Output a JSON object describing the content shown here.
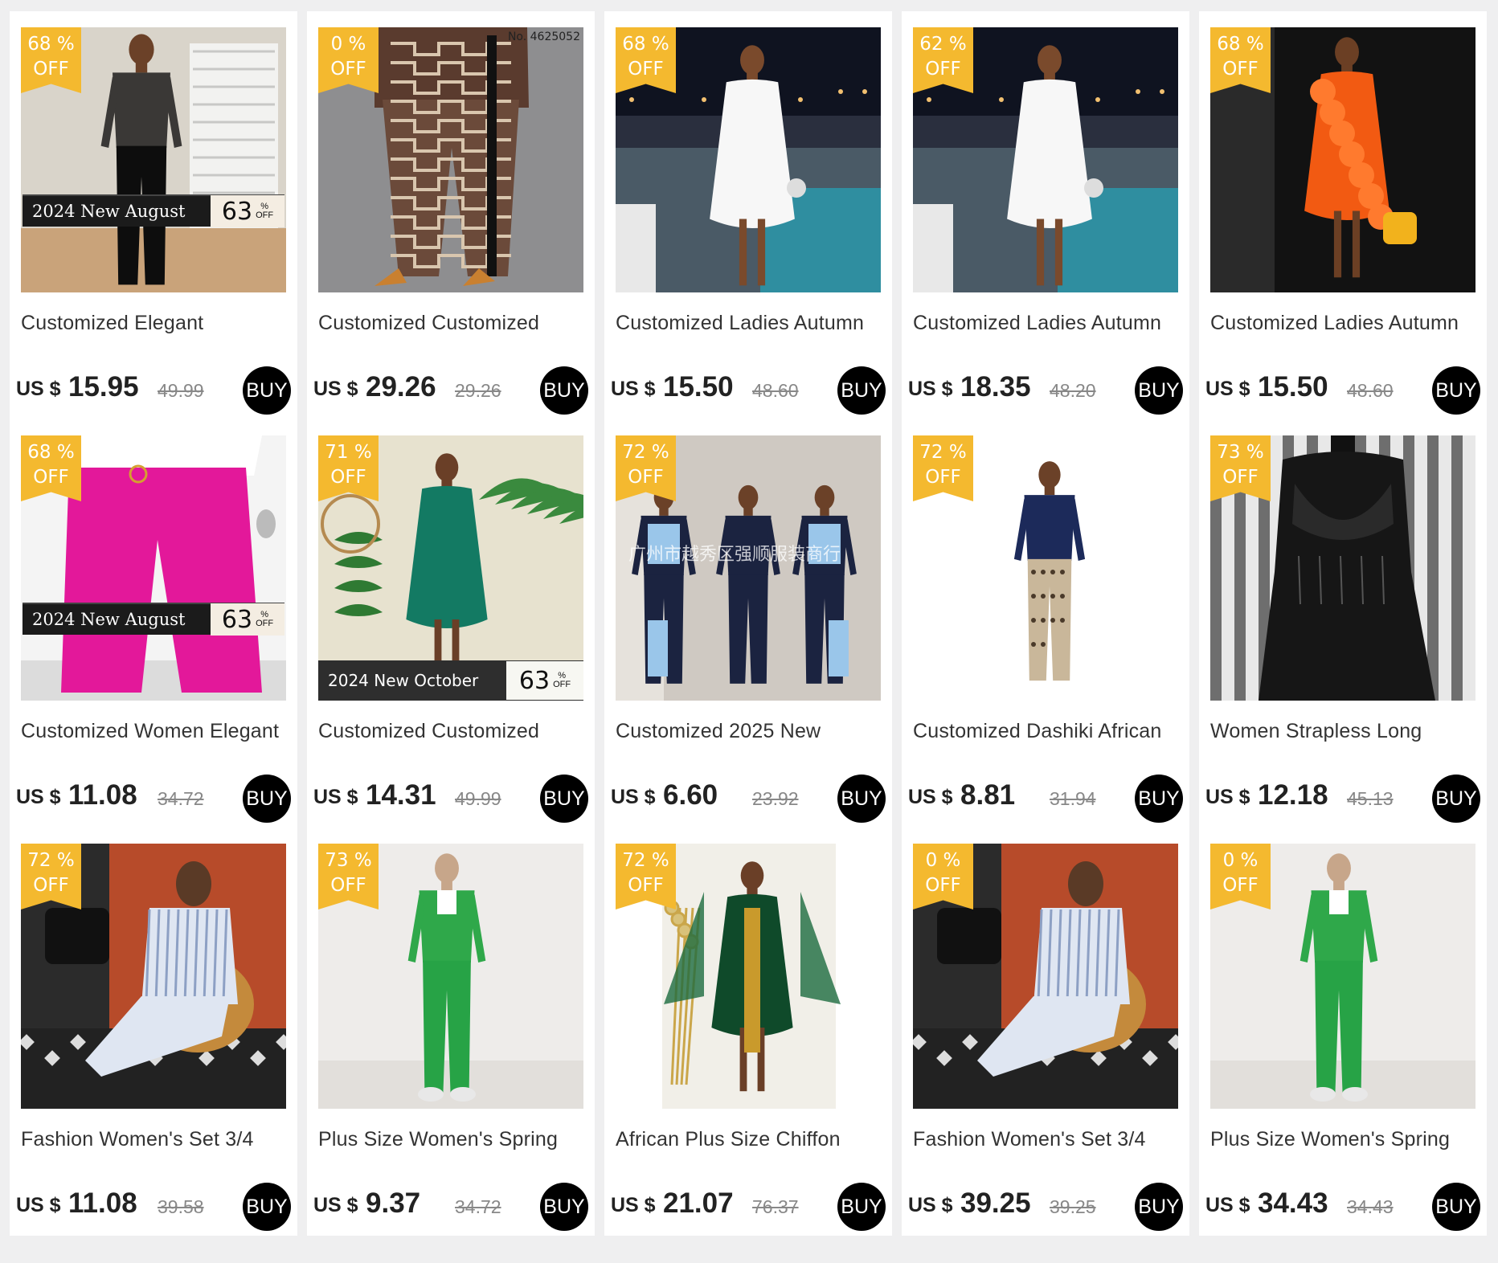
{
  "buy_label": "BUY",
  "currency_label": "US $",
  "off_label": "OFF",
  "percent_label": "%",
  "products": [
    {
      "discount": "68",
      "title": "Customized Elegant",
      "price": "15.95",
      "original": "49.99",
      "promo": "2024 New August",
      "promo_pct": "63",
      "scene": "black-jumpsuit"
    },
    {
      "discount": "0",
      "title": "Customized Customized",
      "price": "29.26",
      "original": "29.26",
      "corner": "No. 4625052",
      "scene": "pattern-pants"
    },
    {
      "discount": "68",
      "title": "Customized Ladies Autumn",
      "price": "15.50",
      "original": "48.60",
      "scene": "white-ruffle-dress"
    },
    {
      "discount": "62",
      "title": "Customized Ladies Autumn",
      "price": "18.35",
      "original": "48.20",
      "scene": "white-ruffle-dress"
    },
    {
      "discount": "68",
      "title": "Customized Ladies Autumn",
      "price": "15.50",
      "original": "48.60",
      "scene": "orange-ruffle-dress"
    },
    {
      "discount": "68",
      "title": "Customized Women Elegant",
      "price": "11.08",
      "original": "34.72",
      "promo": "2024 New August",
      "promo_pct": "63",
      "scene": "pink-pants"
    },
    {
      "discount": "71",
      "title": "Customized Customized",
      "price": "14.31",
      "original": "49.99",
      "promo": "2024 New October",
      "promo_pct": "63",
      "scene": "green-gown"
    },
    {
      "discount": "72",
      "title": "Customized 2025 New",
      "price": "6.60",
      "original": "23.92",
      "watermark": "广州市越秀区强顺服装商行",
      "scene": "three-models"
    },
    {
      "discount": "72",
      "title": "Customized Dashiki African",
      "price": "8.81",
      "original": "31.94",
      "scene": "leopard-set"
    },
    {
      "discount": "73",
      "title": "Women Strapless Long",
      "price": "12.18",
      "original": "45.13",
      "scene": "black-corset-dress"
    },
    {
      "discount": "72",
      "title": "Fashion Women's Set 3/4",
      "price": "11.08",
      "original": "39.58",
      "scene": "striped-set"
    },
    {
      "discount": "73",
      "title": "Plus Size Women's Spring",
      "price": "9.37",
      "original": "34.72",
      "scene": "green-suit"
    },
    {
      "discount": "72",
      "title": "African Plus Size Chiffon",
      "price": "21.07",
      "original": "76.37",
      "scene": "green-chiffon"
    },
    {
      "discount": "0",
      "title": "Fashion Women's Set 3/4",
      "price": "39.25",
      "original": "39.25",
      "scene": "striped-set"
    },
    {
      "discount": "0",
      "title": "Plus Size Women's Spring",
      "price": "34.43",
      "original": "34.43",
      "scene": "green-suit"
    }
  ]
}
